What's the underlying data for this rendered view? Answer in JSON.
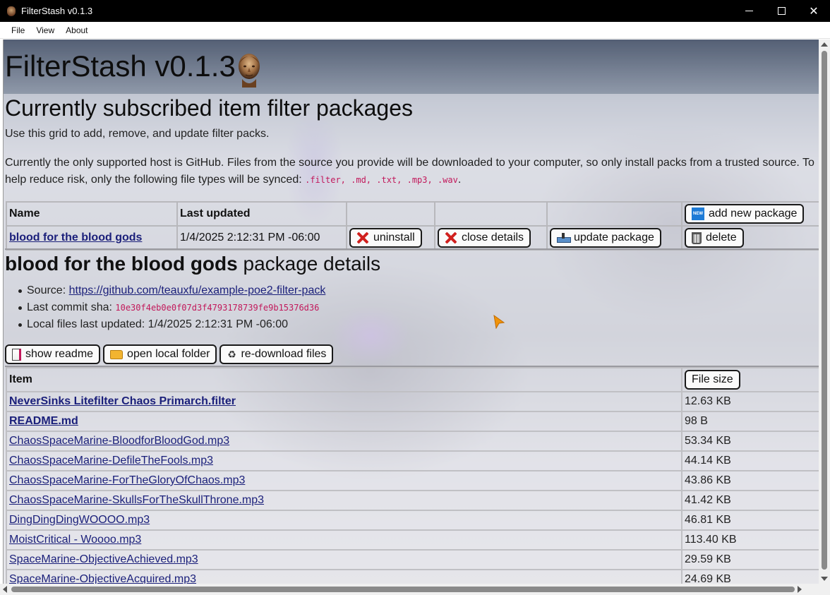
{
  "window": {
    "title": "FilterStash v0.1.3"
  },
  "menu": {
    "items": [
      "File",
      "View",
      "About"
    ]
  },
  "header": {
    "title": "FilterStash v0.1.3"
  },
  "subscribed": {
    "heading": "Currently subscribed item filter packages",
    "intro": "Use this grid to add, remove, and update filter packs.",
    "notice_text": "Currently the only supported host is GitHub. Files from the source you provide will be downloaded to your computer, so only install packs from a trusted source. To help reduce risk, only the following file types will be synced: ",
    "file_types": ".filter, .md, .txt, .mp3, .wav",
    "notice_end": "."
  },
  "packages_table": {
    "col_name": "Name",
    "col_updated": "Last updated",
    "add_button": "add new package",
    "rows": [
      {
        "name": "blood for the blood gods",
        "updated": "1/4/2025 2:12:31 PM -06:00",
        "uninstall": "uninstall",
        "close_details": "close details",
        "update": "update package",
        "delete": "delete"
      }
    ]
  },
  "details": {
    "title_bold": "blood for the blood gods",
    "title_rest": " package details",
    "source_label": "Source: ",
    "source_url": "https://github.com/teauxfu/example-poe2-filter-pack",
    "sha_label": "Last commit sha: ",
    "sha": "10e30f4eb0e0f07d3f4793178739fe9b15376d36",
    "local_label": "Local files last updated: ",
    "local_value": "1/4/2025 2:12:31 PM -06:00",
    "show_readme": "show readme",
    "open_folder": "open local folder",
    "redownload": "re-download files"
  },
  "files_table": {
    "col_item": "Item",
    "col_size": "File size",
    "rows": [
      {
        "name": "NeverSinks Litefilter Chaos Primarch.filter",
        "size": "12.63 KB",
        "bold": true
      },
      {
        "name": "README.md",
        "size": "98 B",
        "bold": true
      },
      {
        "name": "ChaosSpaceMarine-BloodforBloodGod.mp3",
        "size": "53.34 KB",
        "bold": false
      },
      {
        "name": "ChaosSpaceMarine-DefileTheFools.mp3",
        "size": "44.14 KB",
        "bold": false
      },
      {
        "name": "ChaosSpaceMarine-ForTheGloryOfChaos.mp3",
        "size": "43.86 KB",
        "bold": false
      },
      {
        "name": "ChaosSpaceMarine-SkullsForTheSkullThrone.mp3",
        "size": "41.42 KB",
        "bold": false
      },
      {
        "name": "DingDingDingWOOOO.mp3",
        "size": "46.81 KB",
        "bold": false
      },
      {
        "name": "MoistCritical - Woooo.mp3",
        "size": "113.40 KB",
        "bold": false
      },
      {
        "name": "SpaceMarine-ObjectiveAchieved.mp3",
        "size": "29.59 KB",
        "bold": false
      },
      {
        "name": "SpaceMarine-ObjectiveAcquired.mp3",
        "size": "24.69 KB",
        "bold": false
      }
    ]
  },
  "colors": {
    "link": "#1a1f7a",
    "code": "#c2185b",
    "titlebar": "#000000"
  }
}
